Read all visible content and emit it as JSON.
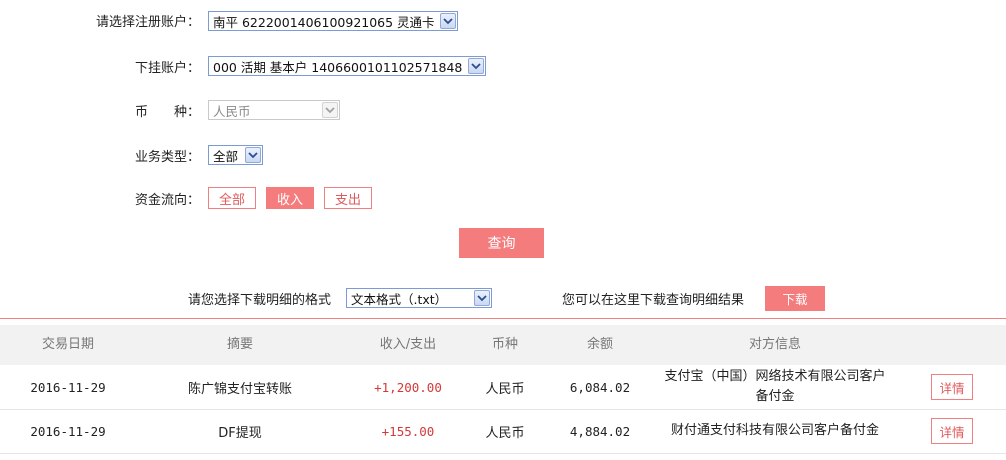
{
  "form": {
    "account": {
      "label": "请选择注册账户：",
      "value": "南平 6222001406100921065 灵通卡"
    },
    "sub_account": {
      "label": "下挂账户：",
      "value": "000 活期 基本户 1406600101102571848"
    },
    "currency": {
      "label": "币　　种：",
      "value": "人民币"
    },
    "business_type": {
      "label": "业务类型：",
      "value": "全部"
    },
    "flow": {
      "label": "资金流向：",
      "options": [
        "全部",
        "收入",
        "支出"
      ],
      "selected": "收入"
    },
    "query_label": "查询"
  },
  "download": {
    "prompt": "请您选择下载明细的格式",
    "format_value": "文本格式（.txt）",
    "hint": "您可以在这里下载查询明细结果",
    "button_label": "下载"
  },
  "table": {
    "headers": [
      "交易日期",
      "摘要",
      "收入/支出",
      "币种",
      "余额",
      "对方信息"
    ],
    "rows": [
      {
        "date": "2016-11-29",
        "summary": "陈广锦支付宝转账",
        "amount": "+1,200.00",
        "currency": "人民币",
        "balance": "6,084.02",
        "party_line1": "支付宝（中国）网络技术有限公司客户",
        "party_line2": "备付金",
        "detail_label": "详情"
      },
      {
        "date": "2016-11-29",
        "summary": "DF提现",
        "amount": "+155.00",
        "currency": "人民币",
        "balance": "4,884.02",
        "party_line1": "财付通支付科技有限公司客户备付金",
        "party_line2": "",
        "detail_label": "详情"
      }
    ]
  },
  "colors": {
    "accent": "#f47c7c",
    "accent_border": "#f08080",
    "amount_text": "#d23a3a",
    "header_bg": "#f2f2f2",
    "select_border": "#7a9cd3"
  }
}
